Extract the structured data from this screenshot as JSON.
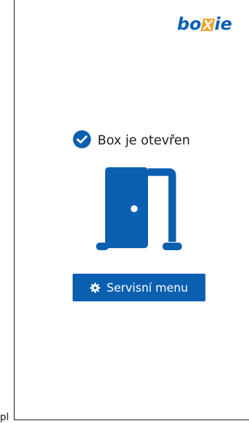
{
  "logo": {
    "prefix": "bo",
    "suffix": "ie",
    "brand_color": "#0a5fb4",
    "accent_color": "#f0a431"
  },
  "status": {
    "icon": "check-circle-icon",
    "text": "Box je otevřen"
  },
  "illustration": {
    "icon": "open-door-icon",
    "color": "#0b5fb0"
  },
  "service_button": {
    "icon": "gear-icon",
    "label": "Servisní menu"
  },
  "stray_text": "pl"
}
